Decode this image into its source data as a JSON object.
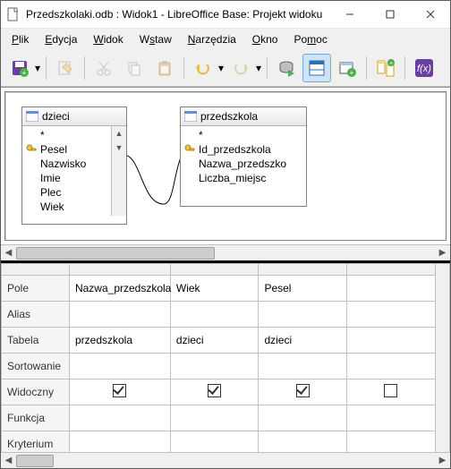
{
  "window": {
    "title": "Przedszkolaki.odb : Widok1 - LibreOffice Base: Projekt widoku"
  },
  "menu": {
    "plik": "Plik",
    "edycja": "Edycja",
    "widok": "Widok",
    "wstaw": "Wstaw",
    "narzedzia": "Narzędzia",
    "okno": "Okno",
    "pomoc": "Pomoc"
  },
  "tables": {
    "t1": {
      "name": "dzieci",
      "fields": [
        "*",
        "Pesel",
        "Nazwisko",
        "Imie",
        "Plec",
        "Wiek"
      ]
    },
    "t2": {
      "name": "przedszkola",
      "fields": [
        "*",
        "Id_przedszkola",
        "Nazwa_przedszko",
        "Liczba_miejsc"
      ]
    }
  },
  "gridlabels": {
    "pole": "Pole",
    "alias": "Alias",
    "tabela": "Tabela",
    "sortowanie": "Sortowanie",
    "widoczny": "Widoczny",
    "funkcja": "Funkcja",
    "kryterium": "Kryterium"
  },
  "cols": [
    {
      "pole": "Nazwa_przedszkola",
      "tabela": "przedszkola",
      "widoczny": true
    },
    {
      "pole": "Wiek",
      "tabela": "dzieci",
      "widoczny": true
    },
    {
      "pole": "Pesel",
      "tabela": "dzieci",
      "widoczny": true
    },
    {
      "pole": "",
      "tabela": "",
      "widoczny": false
    }
  ],
  "chart_data": {
    "type": "table",
    "title": "Query design grid",
    "rows": [
      "Pole",
      "Alias",
      "Tabela",
      "Sortowanie",
      "Widoczny",
      "Funkcja",
      "Kryterium"
    ],
    "columns": [
      {
        "Pole": "Nazwa_przedszkola",
        "Alias": "",
        "Tabela": "przedszkola",
        "Sortowanie": "",
        "Widoczny": true,
        "Funkcja": "",
        "Kryterium": ""
      },
      {
        "Pole": "Wiek",
        "Alias": "",
        "Tabela": "dzieci",
        "Sortowanie": "",
        "Widoczny": true,
        "Funkcja": "",
        "Kryterium": ""
      },
      {
        "Pole": "Pesel",
        "Alias": "",
        "Tabela": "dzieci",
        "Sortowanie": "",
        "Widoczny": true,
        "Funkcja": "",
        "Kryterium": ""
      },
      {
        "Pole": "",
        "Alias": "",
        "Tabela": "",
        "Sortowanie": "",
        "Widoczny": false,
        "Funkcja": "",
        "Kryterium": ""
      }
    ]
  }
}
